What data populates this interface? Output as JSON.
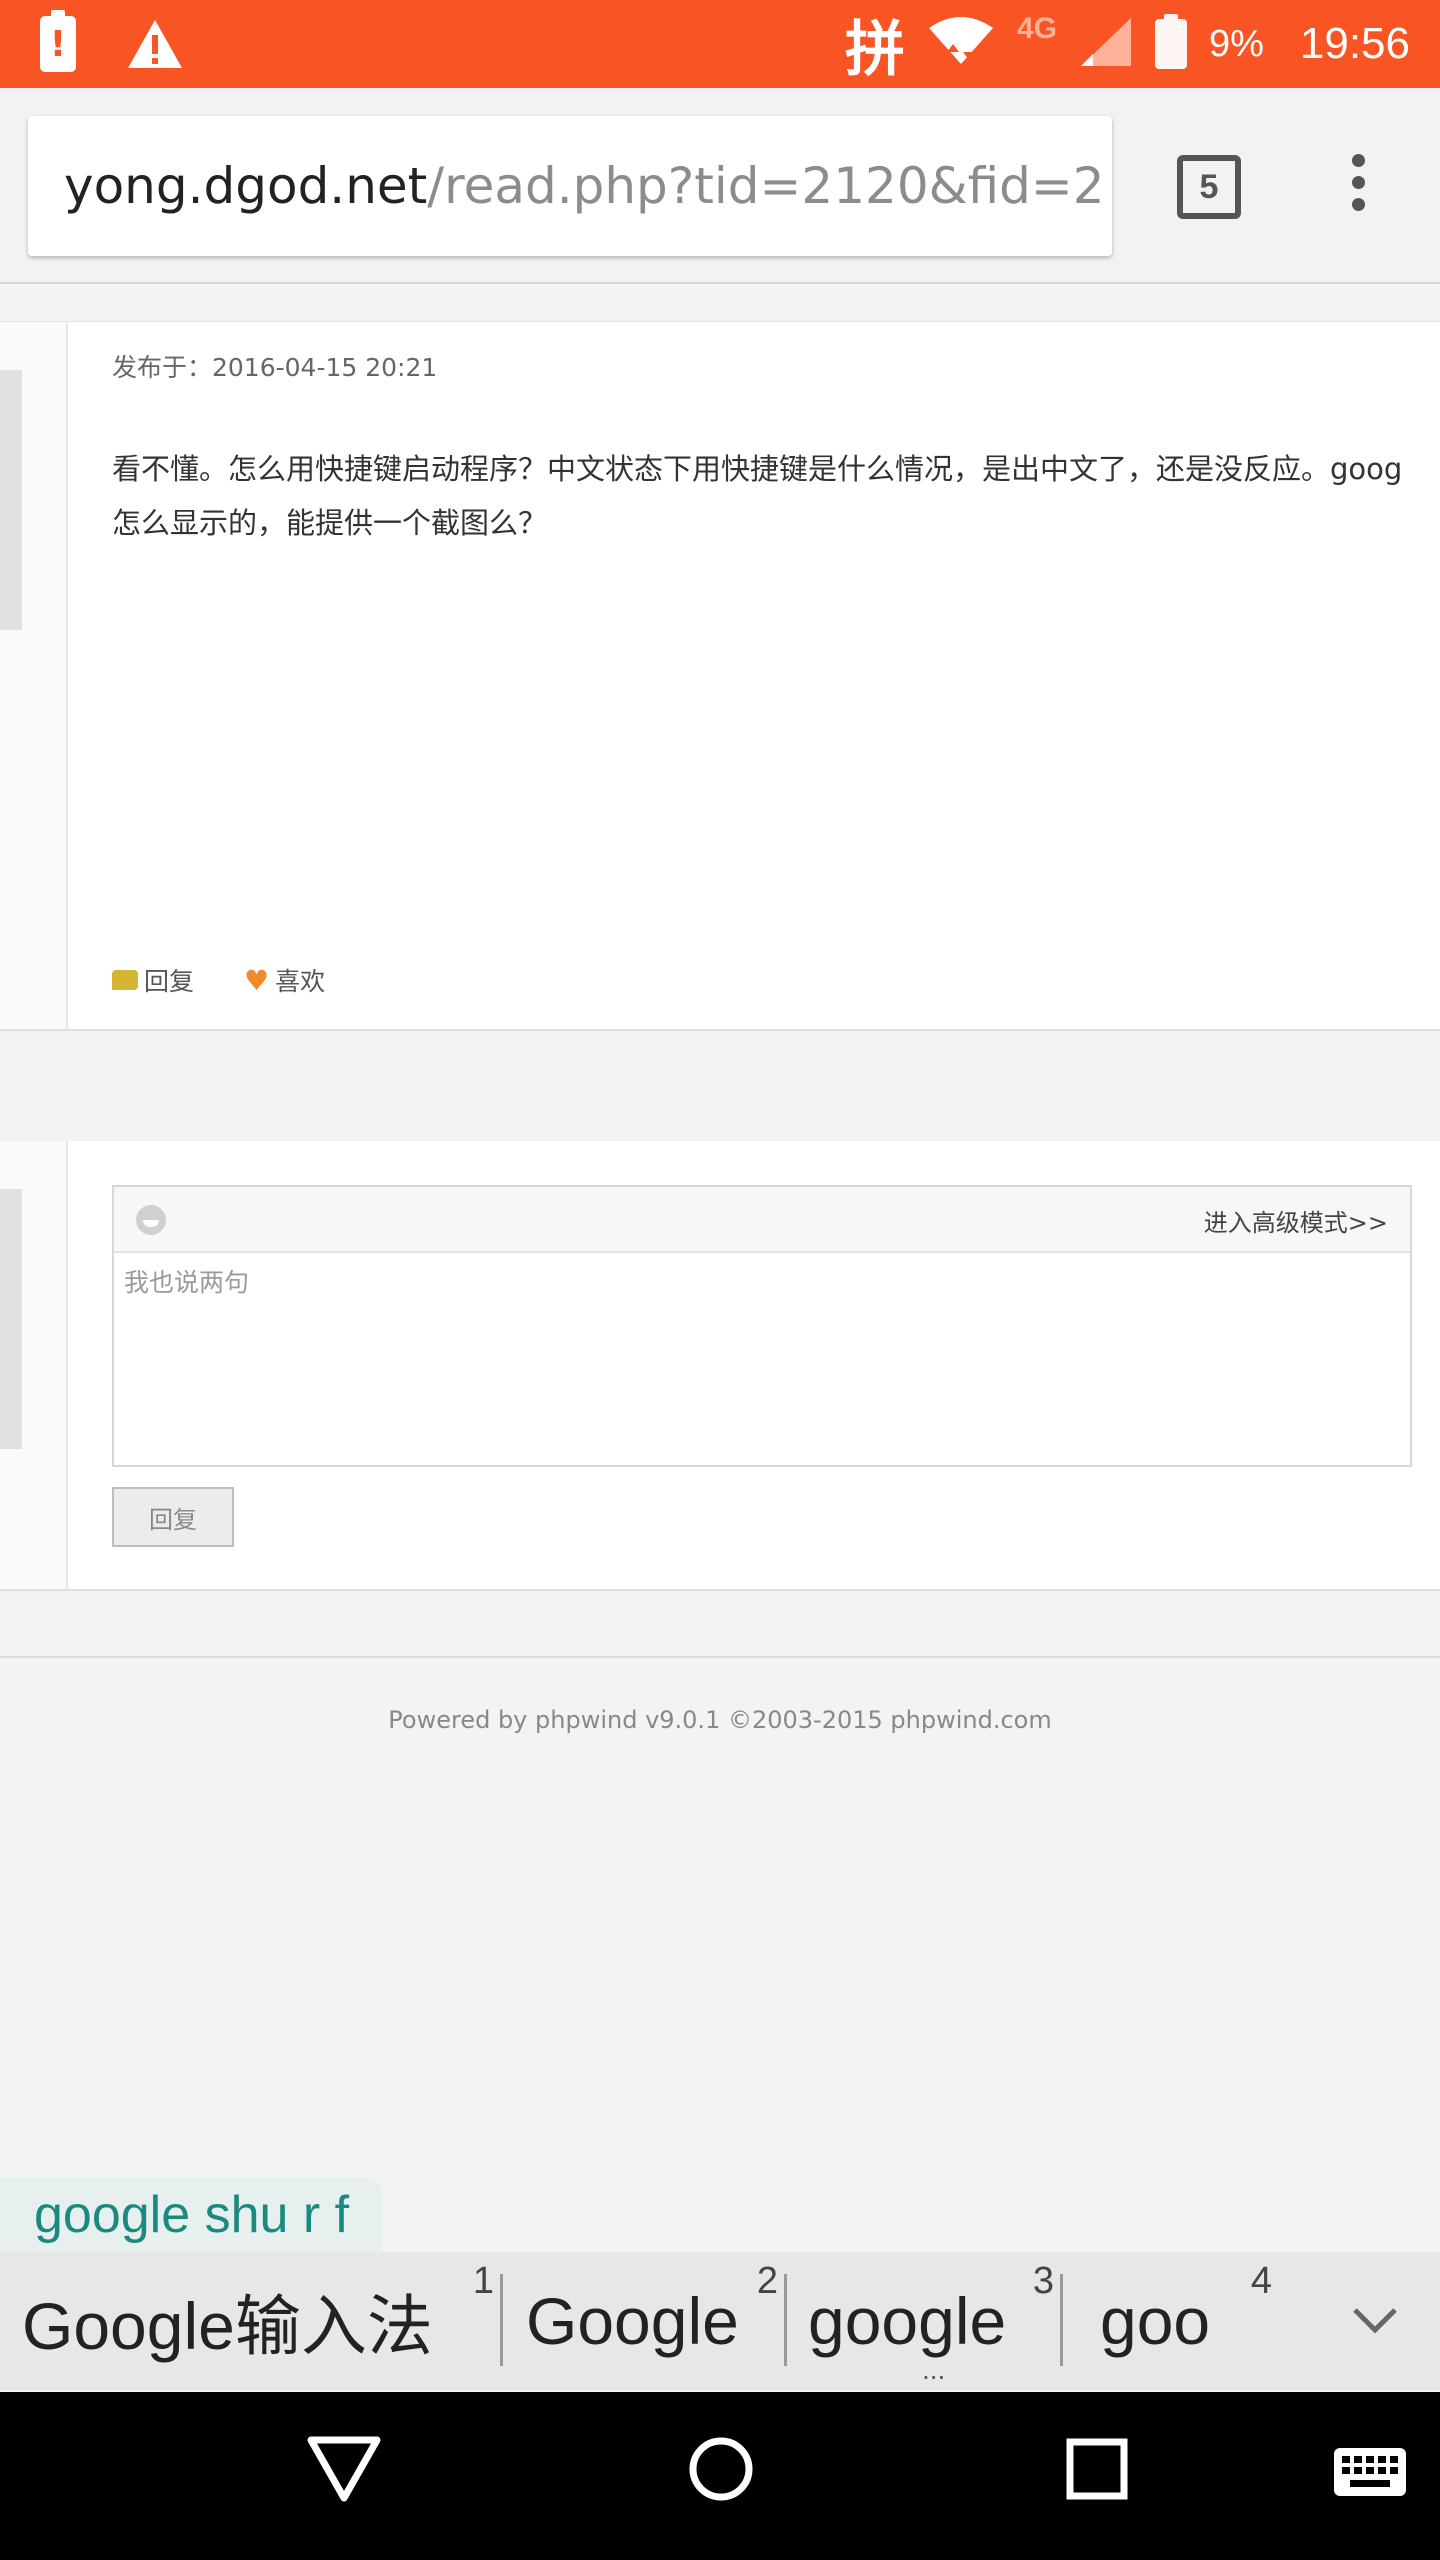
{
  "status_bar": {
    "battery_alert_glyph": "!",
    "input_method_char": "拼",
    "network_label": "4G",
    "battery_percent": "9%",
    "time": "19:56",
    "accent_color": "#f95423"
  },
  "browser": {
    "url_host": "yong.dgod.net",
    "url_path": "/read.php?tid=2120&fid=2",
    "tab_count": "5"
  },
  "post": {
    "date": "发布于：2016-04-15 20:21",
    "body_line1": "看不懂。怎么用快捷键启动程序？中文状态下用快捷键是什么情况，是出中文了，还是没反应。goog",
    "body_line2": "怎么显示的，能提供一个截图么？",
    "reply_label": "回复",
    "like_label": "喜欢"
  },
  "reply_form": {
    "advanced_mode": "进入高级模式>>",
    "placeholder": "我也说两句",
    "submit_label": "回复"
  },
  "footer": {
    "text": "Powered by phpwind v9.0.1 ©2003-2015 phpwind.com"
  },
  "ime": {
    "composing_text": "google shu r f",
    "candidates": [
      {
        "text": "Google输入法",
        "index": "1"
      },
      {
        "text": "Google",
        "index": "2"
      },
      {
        "text": "google",
        "index": "3"
      },
      {
        "text": "goo",
        "index": "4"
      }
    ],
    "more_dots": "..."
  }
}
